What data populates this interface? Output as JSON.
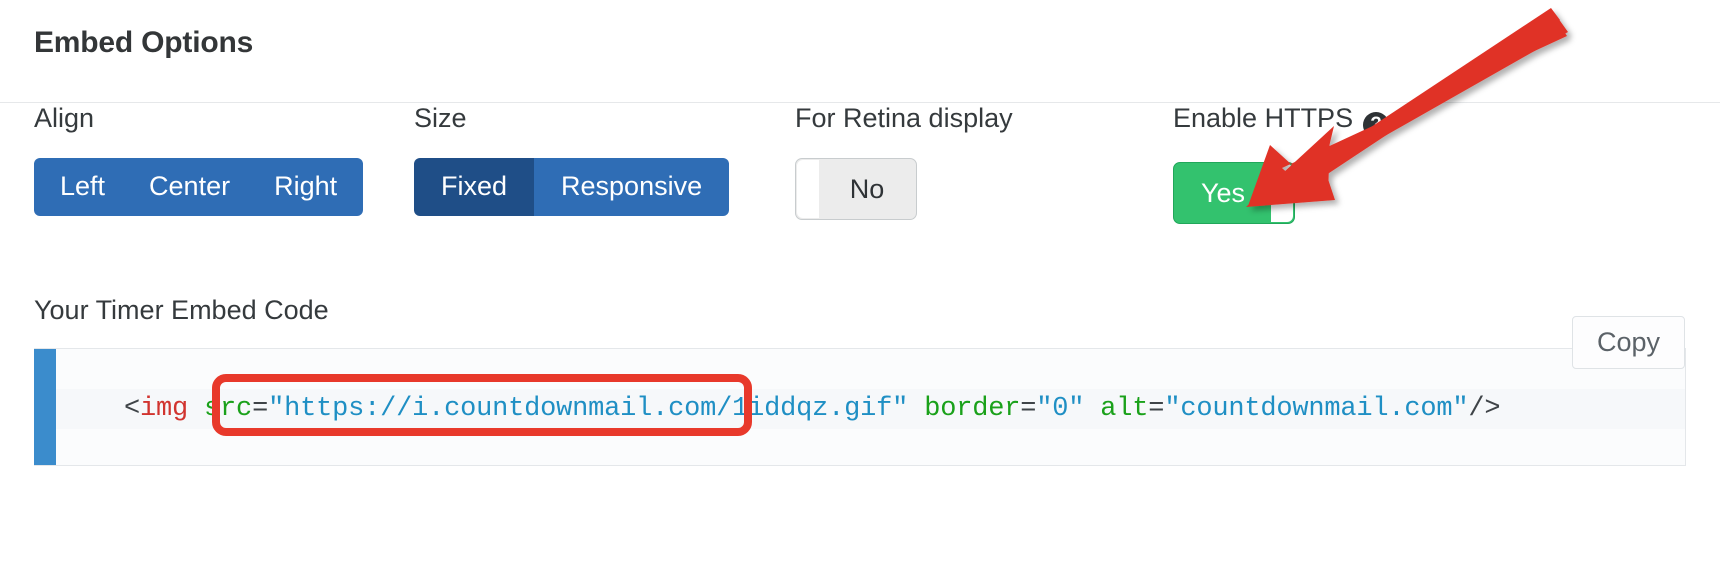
{
  "header": {
    "title": "Embed Options"
  },
  "options": {
    "align": {
      "label": "Align",
      "buttons": [
        {
          "label": "Left",
          "active": false
        },
        {
          "label": "Center",
          "active": false
        },
        {
          "label": "Right",
          "active": false
        }
      ]
    },
    "size": {
      "label": "Size",
      "buttons": [
        {
          "label": "Fixed",
          "active": true
        },
        {
          "label": "Responsive",
          "active": false
        }
      ]
    },
    "retina": {
      "label": "For Retina display",
      "value": "No",
      "state": "off"
    },
    "https": {
      "label": "Enable HTTPS",
      "help_icon": "question-mark-icon",
      "value": "Yes",
      "state": "on"
    }
  },
  "embed": {
    "label": "Your Timer Embed Code",
    "copy_label": "Copy",
    "code": {
      "open_bracket": "<",
      "tag": "img",
      "space1": " ",
      "attr_src": "src",
      "eq1": "=",
      "val_src": "\"https://i.countdownmail.com/1iddqz.gif\"",
      "space2": " ",
      "attr_border": "border",
      "eq2": "=",
      "val_border": "\"0\"",
      "space3": " ",
      "attr_alt": "alt",
      "eq3": "=",
      "val_alt": "\"countdownmail.com\"",
      "close": "/>"
    },
    "full_code": "<img src=\"https://i.countdownmail.com/1iddqz.gif\" border=\"0\" alt=\"countdownmail.com\"/>"
  },
  "colors": {
    "primary_blue": "#2f6db5",
    "active_blue": "#1f4e87",
    "toggle_green": "#33c26e",
    "annotation_red": "#e8392b",
    "code_stripe_blue": "#3b8ccc"
  }
}
